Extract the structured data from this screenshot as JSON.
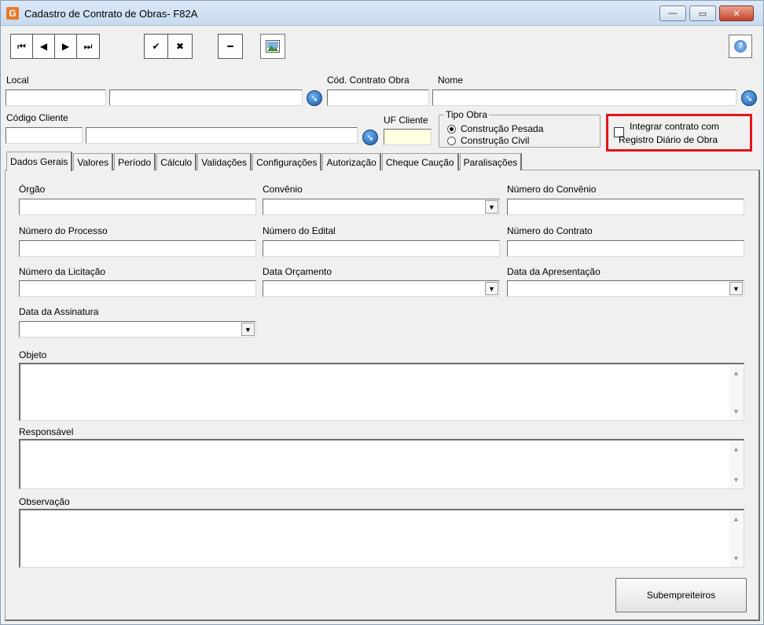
{
  "window": {
    "title": "Cadastro de Contrato de Obras- F82A",
    "app_icon": "G",
    "minimize": "—",
    "maximize": "▭",
    "close": "✕"
  },
  "toolbar": {
    "first": "⏮",
    "prev": "◀",
    "next": "▶",
    "last": "⏭",
    "confirm": "✔",
    "cancel": "✖",
    "delete": "━",
    "help": "?"
  },
  "header": {
    "local_label": "Local",
    "cod_contrato_label": "Cód. Contrato Obra",
    "nome_label": "Nome",
    "codigo_cliente_label": "Código Cliente",
    "uf_cliente_label": "UF Cliente",
    "tipo_obra": {
      "title": "Tipo Obra",
      "options": [
        "Construção Pesada",
        "Construção Civil"
      ],
      "selected": 0
    },
    "integrar": {
      "line1": "Integrar contrato com",
      "line2": "Registro Diário de Obra",
      "checked": false
    }
  },
  "tabs": [
    "Dados Gerais",
    "Valores",
    "Período",
    "Cálculo",
    "Validações",
    "Configurações",
    "Autorização",
    "Cheque Caução",
    "Paralisações"
  ],
  "active_tab": 0,
  "form": {
    "orgao": "Órgão",
    "convenio": "Convênio",
    "numero_convenio": "Número do Convênio",
    "numero_processo": "Número do Processo",
    "numero_edital": "Número do Edital",
    "numero_contrato": "Número do Contrato",
    "numero_licitacao": "Número da Licitação",
    "data_orcamento": "Data Orçamento",
    "data_apresentacao": "Data da Apresentação",
    "data_assinatura": "Data da Assinatura",
    "objeto": "Objeto",
    "responsavel": "Responsável",
    "observacao": "Observação"
  },
  "buttons": {
    "subempreiteiros": "Subempreiteiros"
  },
  "colors": {
    "highlight_box": "#e3141b",
    "title_bar": "#c7daf0"
  },
  "icons": {
    "lookup": "arrow-circle-icon",
    "image": "landscape-image-icon",
    "help": "help-circle-icon"
  }
}
